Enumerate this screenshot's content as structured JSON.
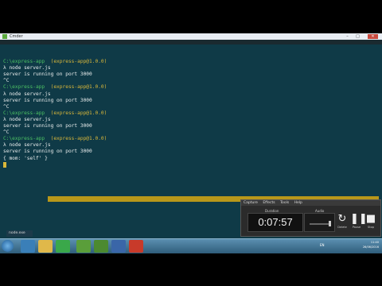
{
  "window": {
    "title": "Cmder",
    "min": "–",
    "max": "□",
    "close": "✕"
  },
  "console_lines": [
    [
      {
        "t": "",
        "c": ""
      }
    ],
    [
      {
        "t": "C:\\express-app",
        "c": "path"
      },
      {
        "t": "  (express-app@1.0.0)",
        "c": "pkg"
      }
    ],
    [
      {
        "t": "λ node server.js",
        "c": ""
      }
    ],
    [
      {
        "t": "server is running on port 3000",
        "c": ""
      }
    ],
    [
      {
        "t": "^C",
        "c": ""
      }
    ],
    [
      {
        "t": "C:\\express-app",
        "c": "path"
      },
      {
        "t": "  (express-app@1.0.0)",
        "c": "pkg"
      }
    ],
    [
      {
        "t": "λ node server.js",
        "c": ""
      }
    ],
    [
      {
        "t": "server is running on port 3000",
        "c": ""
      }
    ],
    [
      {
        "t": "^C",
        "c": ""
      }
    ],
    [
      {
        "t": "C:\\express-app",
        "c": "path"
      },
      {
        "t": "  (express-app@1.0.0)",
        "c": "pkg"
      }
    ],
    [
      {
        "t": "λ node server.js",
        "c": ""
      }
    ],
    [
      {
        "t": "server is running on port 3000",
        "c": ""
      }
    ],
    [
      {
        "t": "^C",
        "c": ""
      }
    ],
    [
      {
        "t": "C:\\express-app",
        "c": "path"
      },
      {
        "t": "  (express-app@1.0.0)",
        "c": "pkg"
      }
    ],
    [
      {
        "t": "λ node server.js",
        "c": ""
      }
    ],
    [
      {
        "t": "server is running on port 3000",
        "c": ""
      }
    ],
    [
      {
        "t": "{ mom: 'self' }",
        "c": ""
      }
    ]
  ],
  "recorder": {
    "menu": [
      "Capture",
      "Effects",
      "Tools",
      "Help"
    ],
    "duration_label": "Duration",
    "timer": "0:07:57",
    "audio_label": "Audio",
    "delete_label": "Delete",
    "pause_label": "Pause",
    "stop_label": "Stop"
  },
  "taskbar": {
    "active_tab": "node.exe",
    "tray_lang": "EN",
    "time": "11:40",
    "date": "26/06/2016"
  },
  "colors": {
    "console_bg": "#0f3a47",
    "path": "#4cc264",
    "pkg": "#d9b73a",
    "highlight": "#b8971a"
  }
}
